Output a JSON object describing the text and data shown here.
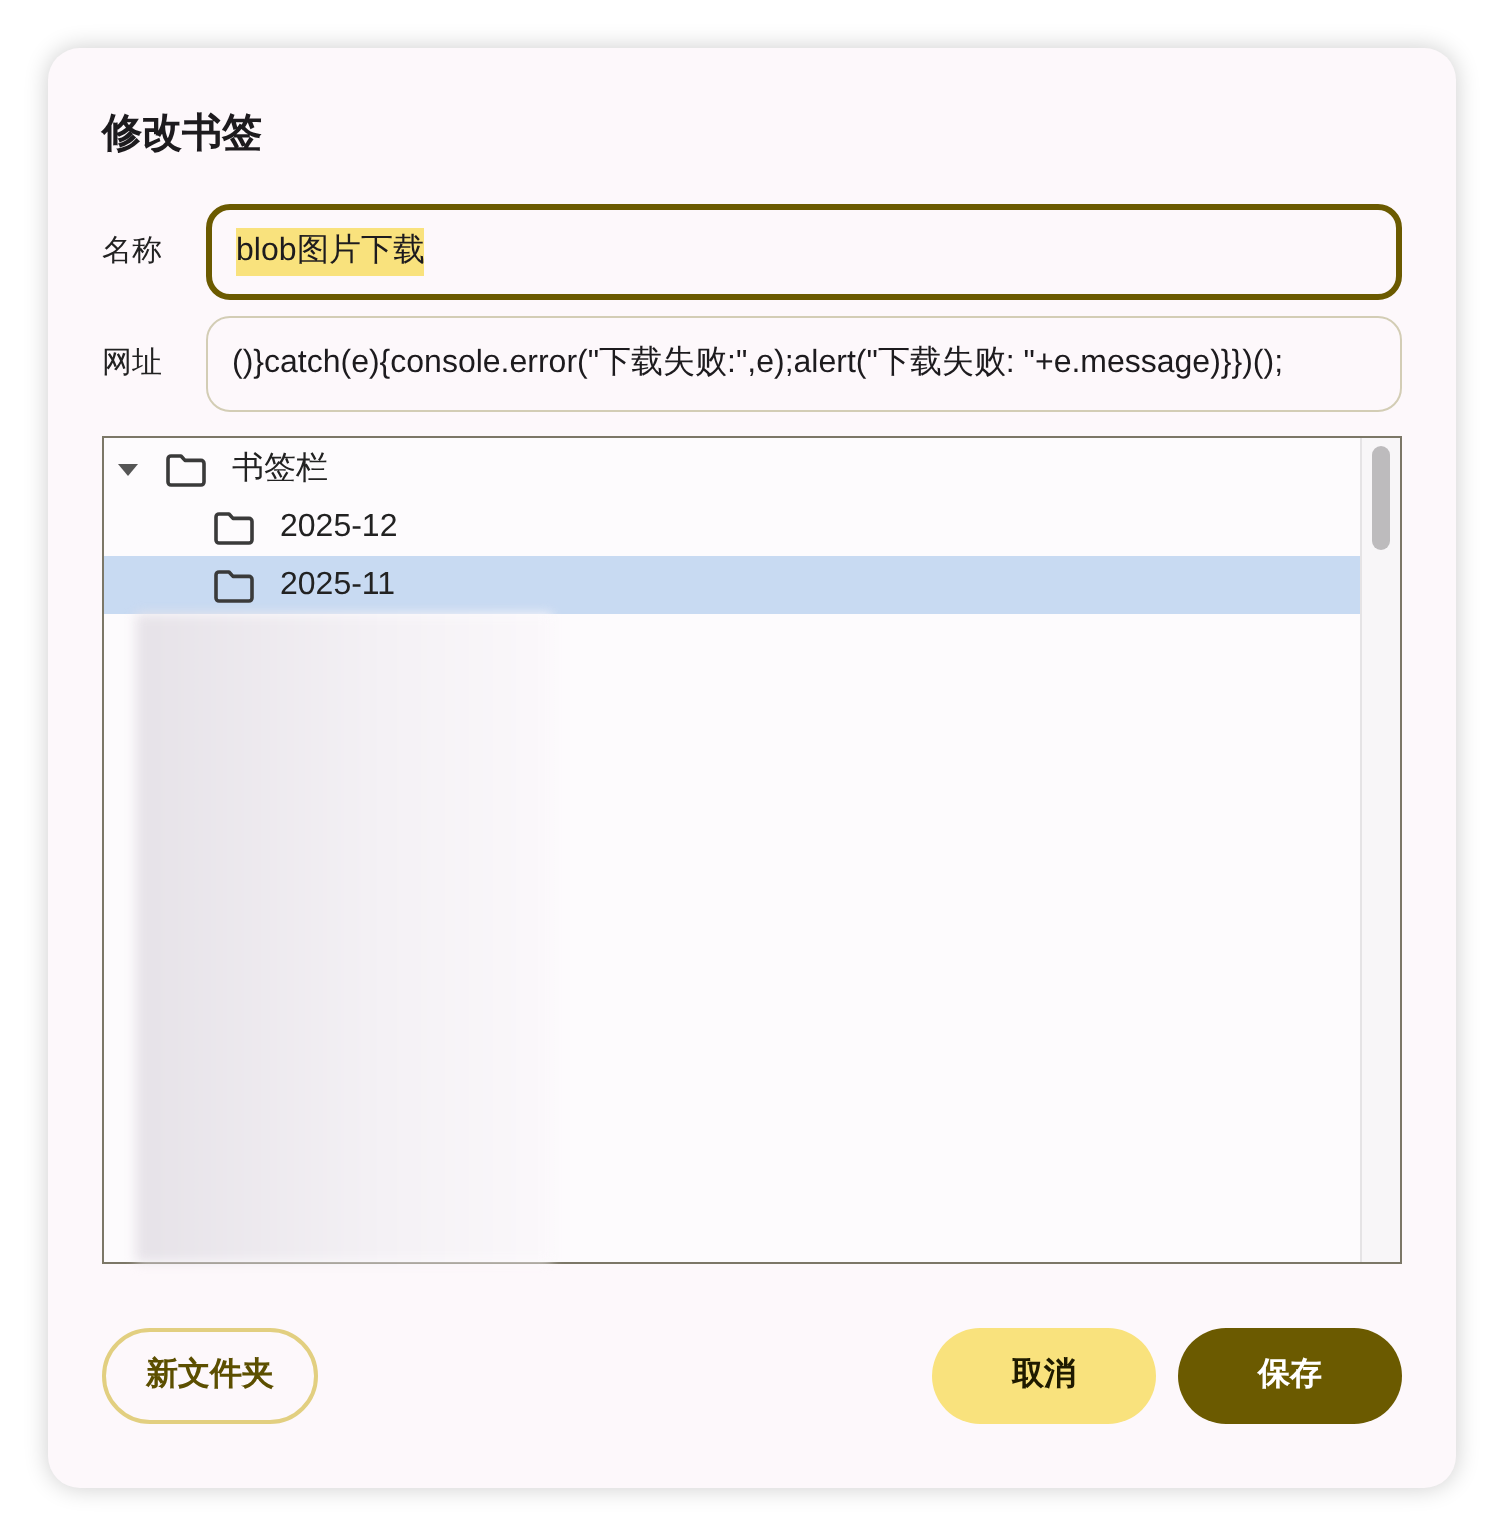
{
  "dialog": {
    "title": "修改书签"
  },
  "fields": [
    {
      "label": "名称",
      "value": "blob图片下载",
      "focused": true,
      "text_selected": true
    },
    {
      "label": "网址",
      "value": "()}catch(e){console.error(\"下载失败:\",e);alert(\"下载失败: \"+e.message)}})();",
      "focused": false,
      "text_selected": false
    }
  ],
  "folder_tree": [
    {
      "label": "书签栏",
      "expanded": true,
      "selected": false,
      "children": [
        {
          "label": "2025-12",
          "selected": false
        },
        {
          "label": "2025-11",
          "selected": true
        }
      ]
    }
  ],
  "buttons": [
    {
      "label": "新文件夹",
      "kind": "outline"
    },
    {
      "label": "取消",
      "kind": "tonal"
    },
    {
      "label": "保存",
      "kind": "filled"
    }
  ]
}
